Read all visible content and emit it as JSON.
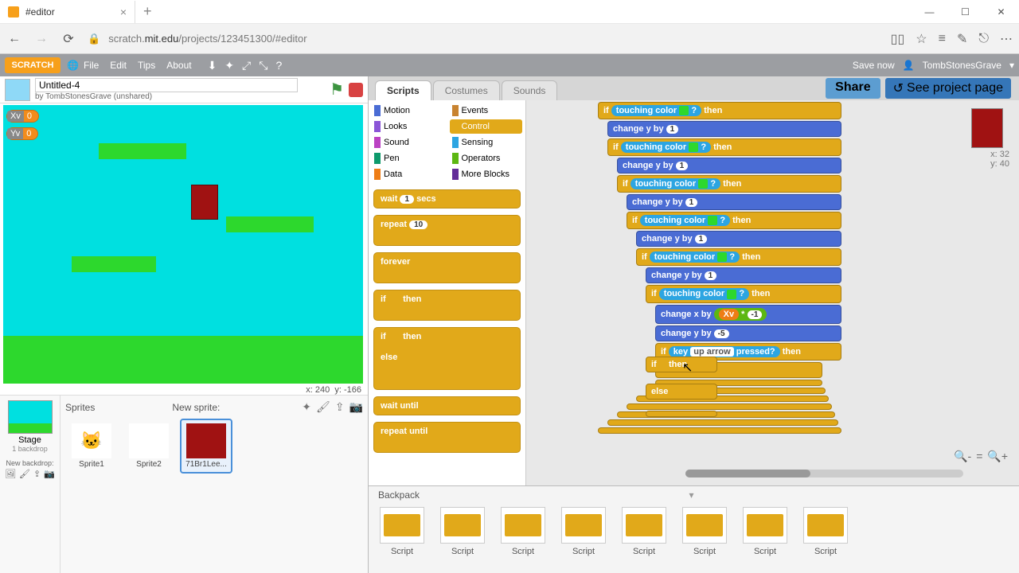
{
  "browser": {
    "tab_title": "#editor",
    "url_prefix": "scratch.",
    "url_domain": "mit.edu",
    "url_path": "/projects/123451300/#editor"
  },
  "menu": {
    "file": "File",
    "edit": "Edit",
    "tips": "Tips",
    "about": "About",
    "save": "Save now",
    "user": "TombStonesGrave",
    "share": "Share",
    "see": "See project page"
  },
  "project": {
    "title": "Untitled-4",
    "by": "by TombStonesGrave (unshared)"
  },
  "monitors": {
    "xv": "Xv",
    "xv_val": "0",
    "yv": "Yv",
    "yv_val": "0"
  },
  "stage_coords": {
    "x": "x: 240",
    "y": "y: -166"
  },
  "script_coords": {
    "x": "x: 32",
    "y": "y: 40"
  },
  "spritepane": {
    "sprites": "Sprites",
    "newsprite": "New sprite:",
    "stage": "Stage",
    "backdrop": "1 backdrop",
    "newbackdrop": "New backdrop:",
    "s1": "Sprite1",
    "s2": "Sprite2",
    "s3": "71Br1Lee..."
  },
  "tabs": {
    "scripts": "Scripts",
    "costumes": "Costumes",
    "sounds": "Sounds"
  },
  "cats": {
    "motion": "Motion",
    "events": "Events",
    "looks": "Looks",
    "control": "Control",
    "sound": "Sound",
    "sensing": "Sensing",
    "pen": "Pen",
    "operators": "Operators",
    "data": "Data",
    "more": "More Blocks"
  },
  "palette": {
    "wait": "wait",
    "secs": "secs",
    "wait_n": "1",
    "repeat": "repeat",
    "repeat_n": "10",
    "forever": "forever",
    "if": "if",
    "then": "then",
    "else": "else",
    "waituntil": "wait until",
    "repeatuntil": "repeat until"
  },
  "script": {
    "touching": "touching color",
    "q": "?",
    "then": "then",
    "if": "if",
    "else": "else",
    "changey": "change y by",
    "one": "1",
    "changex": "change x by",
    "xv": "Xv",
    "times": "*",
    "neg1": "-1",
    "neg5": "-5",
    "key": "key",
    "uparrow": "up arrow",
    "pressed": "pressed?"
  },
  "backpack": {
    "title": "Backpack",
    "script": "Script"
  }
}
